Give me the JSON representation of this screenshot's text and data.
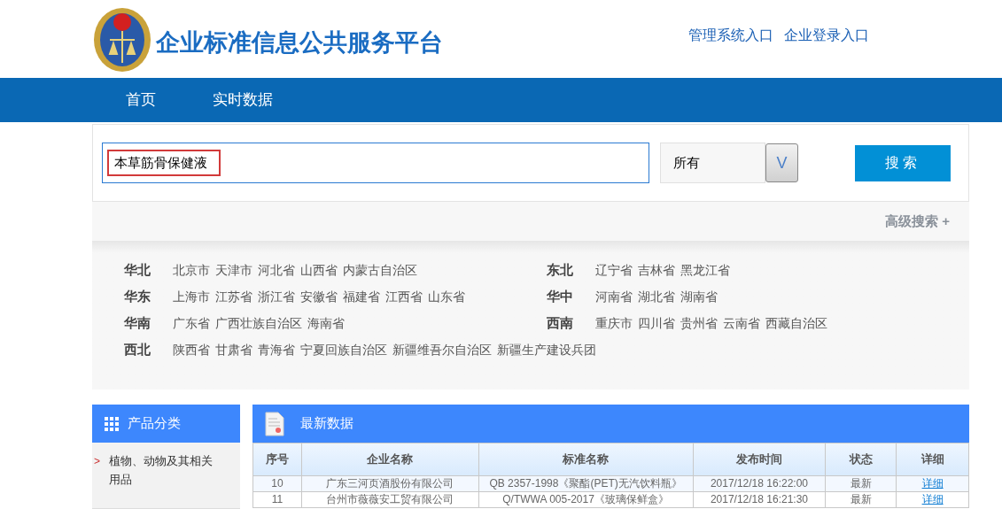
{
  "header": {
    "title": "企业标准信息公共服务平台",
    "links": [
      "管理系统入口",
      "企业登录入口"
    ]
  },
  "nav": [
    {
      "label": "首页",
      "selected": false
    },
    {
      "label": "实时数据",
      "selected": false
    }
  ],
  "search": {
    "value": "本草筋骨保健液",
    "scope": "所有",
    "dropdown_symbol": "V",
    "button": "搜索",
    "advanced": "高级搜索 +"
  },
  "regions": [
    {
      "name": "华北",
      "places": [
        "北京市",
        "天津市",
        "河北省",
        "山西省",
        "内蒙古自治区"
      ]
    },
    {
      "name": "东北",
      "places": [
        "辽宁省",
        "吉林省",
        "黑龙江省"
      ]
    },
    {
      "name": "华东",
      "places": [
        "上海市",
        "江苏省",
        "浙江省",
        "安徽省",
        "福建省",
        "江西省",
        "山东省"
      ]
    },
    {
      "name": "华中",
      "places": [
        "河南省",
        "湖北省",
        "湖南省"
      ]
    },
    {
      "name": "华南",
      "places": [
        "广东省",
        "广西壮族自治区",
        "海南省"
      ]
    },
    {
      "name": "西南",
      "places": [
        "重庆市",
        "四川省",
        "贵州省",
        "云南省",
        "西藏自治区"
      ]
    },
    {
      "name": "西北",
      "places": [
        "陕西省",
        "甘肃省",
        "青海省",
        "宁夏回族自治区",
        "新疆维吾尔自治区",
        "新疆生产建设兵团"
      ]
    }
  ],
  "sidebar": {
    "title": "产品分类",
    "items": [
      {
        "label": "植物、动物及其相关用品",
        "marker": ">"
      }
    ]
  },
  "table": {
    "title": "最新数据",
    "columns": [
      "序号",
      "企业名称",
      "标准名称",
      "发布时间",
      "状态",
      "详细"
    ],
    "rows": [
      [
        "10",
        "广东三河页酒股份有限公司",
        "QB 2357-1998《聚酯(PET)无汽饮料瓶》",
        "2017/12/18 16:22:00",
        "最新",
        "详细"
      ],
      [
        "11",
        "台州市薇薇安工贸有限公司",
        "Q/TWWA 005-2017《玻璃保鲜盒》",
        "2017/12/18 16:21:30",
        "最新",
        "详细"
      ]
    ]
  }
}
